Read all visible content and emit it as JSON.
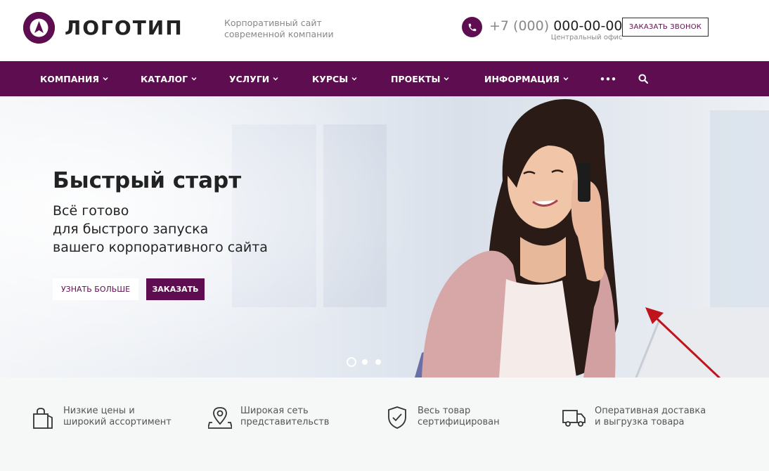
{
  "header": {
    "logo_text": "ЛОГОТИП",
    "slogan_line1": "Корпоративный сайт",
    "slogan_line2": "современной компании",
    "phone_prefix": "+7 (000)",
    "phone_number": "000-00-00",
    "phone_caption": "Центральный офис",
    "callback_label": "ЗАКАЗАТЬ ЗВОНОК"
  },
  "nav": {
    "items": [
      {
        "label": "КОМПАНИЯ"
      },
      {
        "label": "КАТАЛОГ"
      },
      {
        "label": "УСЛУГИ"
      },
      {
        "label": "КУРСЫ"
      },
      {
        "label": "ПРОЕКТЫ"
      },
      {
        "label": "ИНФОРМАЦИЯ"
      }
    ],
    "more_label": "•••"
  },
  "hero": {
    "title": "Быстрый старт",
    "subtitle_line1": "Всё готово",
    "subtitle_line2": "для быстрого запуска",
    "subtitle_line3": "вашего корпоративного сайта",
    "btn_more": "УЗНАТЬ БОЛЬШЕ",
    "btn_order": "ЗАКАЗАТЬ",
    "slide_count": 3,
    "active_slide": 1
  },
  "features": [
    {
      "icon": "shopping-bag-icon",
      "line1": "Низкие цены и",
      "line2": "широкий ассортимент"
    },
    {
      "icon": "map-pin-icon",
      "line1": "Широкая сеть",
      "line2": "представительств"
    },
    {
      "icon": "shield-check-icon",
      "line1": "Весь товар",
      "line2": "сертифицирован"
    },
    {
      "icon": "truck-icon",
      "line1": "Оперативная доставка",
      "line2": "и выгрузка товара"
    }
  ],
  "colors": {
    "brand": "#5e0d50",
    "annotation_arrow": "#c0141c",
    "features_bg": "#f6f7f7"
  }
}
